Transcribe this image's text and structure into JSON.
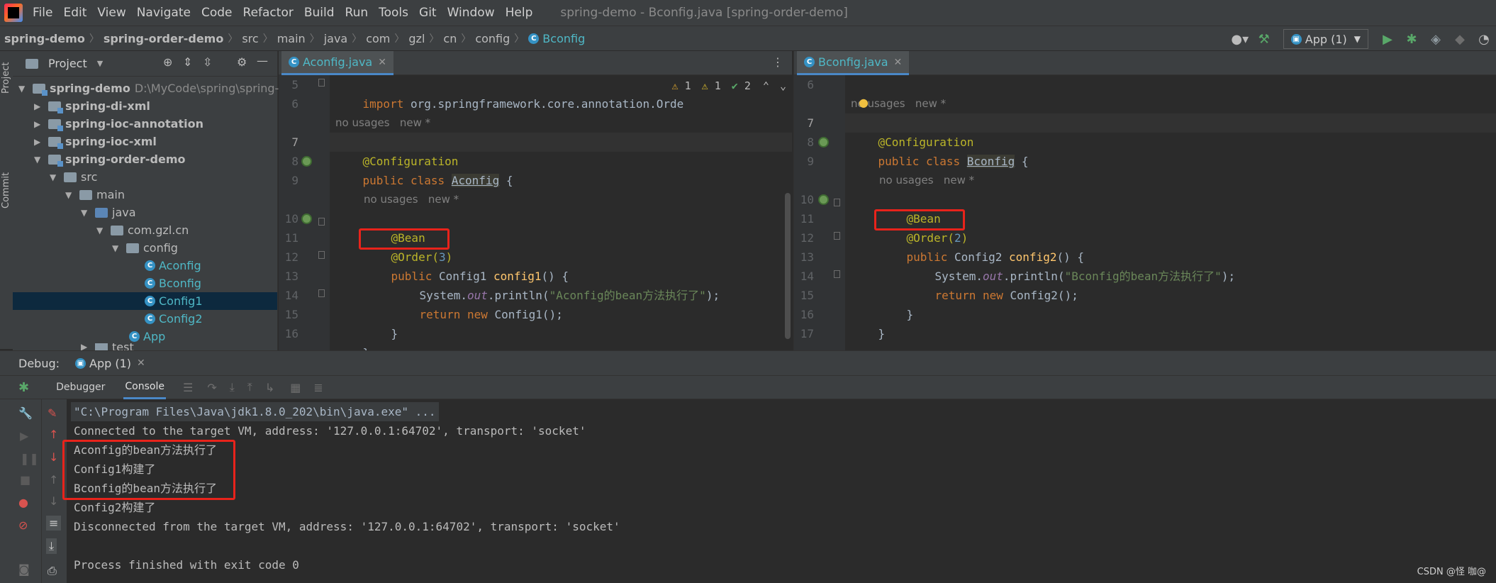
{
  "window_title": "spring-demo - Bconfig.java [spring-order-demo]",
  "menu": [
    "File",
    "Edit",
    "View",
    "Navigate",
    "Code",
    "Refactor",
    "Build",
    "Run",
    "Tools",
    "Git",
    "Window",
    "Help"
  ],
  "breadcrumbs": [
    "spring-demo",
    "spring-order-demo",
    "src",
    "main",
    "java",
    "com",
    "gzl",
    "cn",
    "config",
    "Bconfig"
  ],
  "run_config": "App (1)",
  "left_strip": {
    "project": "Project",
    "commit": "Commit"
  },
  "project_panel": {
    "title": "Project",
    "tree": [
      {
        "label": "spring-demo",
        "path": "D:\\MyCode\\spring\\spring-de"
      },
      {
        "label": "spring-di-xml"
      },
      {
        "label": "spring-ioc-annotation"
      },
      {
        "label": "spring-ioc-xml"
      },
      {
        "label": "spring-order-demo"
      },
      {
        "label": "src"
      },
      {
        "label": "main"
      },
      {
        "label": "java"
      },
      {
        "label": "com.gzl.cn"
      },
      {
        "label": "config"
      },
      {
        "label": "Aconfig"
      },
      {
        "label": "Bconfig"
      },
      {
        "label": "Config1"
      },
      {
        "label": "Config2"
      },
      {
        "label": "App"
      },
      {
        "label": "test"
      }
    ]
  },
  "left_editor": {
    "tab": "Aconfig.java",
    "inspections": {
      "warn1": "1",
      "warn2": "1",
      "ok": "2"
    },
    "line_numbers": [
      "5",
      "6",
      "7",
      "8",
      "9",
      "10",
      "11",
      "12",
      "13",
      "14",
      "15",
      "16"
    ],
    "hints": {
      "class_hint": "no usages   new *",
      "method_hint": "no usages   new *"
    },
    "code": {
      "import_kw": "import",
      "import_path": " org.springframework.core.annotation.Orde",
      "annotation_config": "@Configuration",
      "class_decl_kw": "public class ",
      "class_name": "Aconfig",
      "class_brace": " {",
      "bean": "@Bean",
      "order_ann": "@Order(",
      "order_value": "3",
      "order_close": ")",
      "method_kw": "public ",
      "method_type": "Config1 ",
      "method_name": "config1",
      "method_rest": "() {",
      "print_prefix": "System.",
      "print_field": "out",
      "print_call": ".println(",
      "print_string": "\"Aconfig的bean方法执行了\"",
      "print_end": ");",
      "return_kw": "return new ",
      "return_rest": "Config1();",
      "close_method": "}",
      "close_class": "}"
    }
  },
  "right_editor": {
    "tab": "Bconfig.java",
    "line_numbers": [
      "6",
      "7",
      "8",
      "9",
      "10",
      "11",
      "12",
      "13",
      "14",
      "15",
      "16",
      "17"
    ],
    "hints": {
      "class_hint": "no usages   new *",
      "method_hint": "no usages   new *"
    },
    "code": {
      "annotation_config": "@Configuration",
      "class_decl_kw": "public class ",
      "class_name": "Bconfig",
      "class_brace": " {",
      "bean": "@Bean",
      "order_ann": "@Order(",
      "order_value": "2",
      "order_close": ")",
      "method_kw": "public ",
      "method_type": "Config2 ",
      "method_name": "config2",
      "method_rest": "() {",
      "print_prefix": "System.",
      "print_field": "out",
      "print_call": ".println(",
      "print_string": "\"Bconfig的bean方法执行了\"",
      "print_end": ");",
      "return_kw": "return new ",
      "return_rest": "Config2();",
      "close_method": "}",
      "close_class": "}"
    }
  },
  "debug": {
    "label": "Debug:",
    "session_tab": "App (1)",
    "tabs": [
      "Debugger",
      "Console"
    ],
    "console": [
      "\"C:\\Program Files\\Java\\jdk1.8.0_202\\bin\\java.exe\" ...",
      "Connected to the target VM, address: '127.0.0.1:64702', transport: 'socket'",
      "Aconfig的bean方法执行了",
      "Config1构建了",
      "Bconfig的bean方法执行了",
      "Config2构建了",
      "Disconnected from the target VM, address: '127.0.0.1:64702', transport: 'socket'",
      "",
      "Process finished with exit code 0"
    ]
  },
  "watermark": "CSDN @怪 咖@",
  "colors": {
    "accent_red": "#e8231b",
    "keyword": "#cc7832",
    "annotation": "#bbb529",
    "string": "#6a8759",
    "function": "#ffc66d",
    "number": "#6897bb"
  }
}
